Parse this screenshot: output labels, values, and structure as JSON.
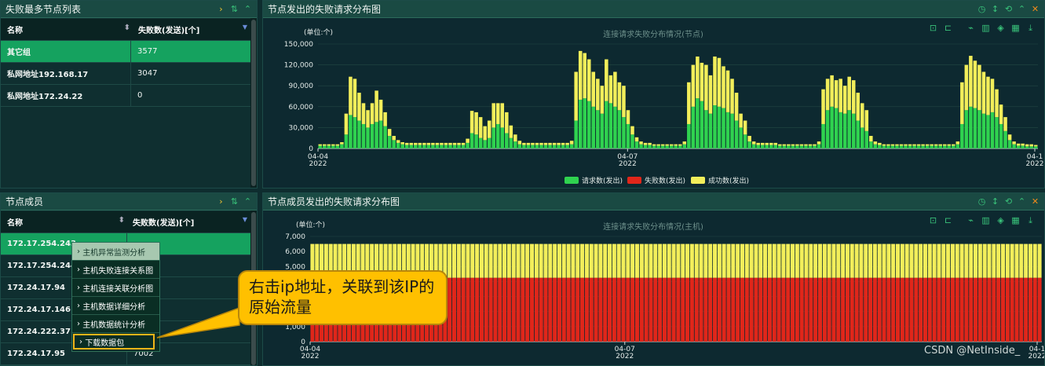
{
  "colors": {
    "request": "#2fd24f",
    "fail": "#e0261a",
    "success": "#f2ee5a",
    "accent": "#15a25f"
  },
  "left_top": {
    "title": "失败最多节点列表",
    "col_name": "名称",
    "col_fail": "失败数(发送)[个]",
    "rows": [
      {
        "name": "其它组",
        "value": "3577"
      },
      {
        "name": "私网地址192.168.17",
        "value": "3047"
      },
      {
        "name": "私网地址172.24.22",
        "value": "0"
      }
    ]
  },
  "left_bottom": {
    "title": "节点成员",
    "col_name": "名称",
    "col_fail": "失败数(发送)[个]",
    "rows": [
      {
        "name": "172.17.254.243",
        "value": ""
      },
      {
        "name": "172.17.254.244",
        "value": ""
      },
      {
        "name": "172.24.17.94",
        "value": ""
      },
      {
        "name": "172.24.17.146",
        "value": ""
      },
      {
        "name": "172.24.222.37",
        "value": ""
      },
      {
        "name": "172.24.17.95",
        "value": "7002"
      }
    ]
  },
  "context_menu": {
    "items": [
      "主机异常监测分析",
      "主机失败连接关系图",
      "主机连接关联分析图",
      "主机数据详细分析",
      "主机数据统计分析",
      "下载数据包"
    ]
  },
  "callout": {
    "text": "右击ip地址，关联到该IP的原始流量"
  },
  "top_chart_panel": {
    "title": "节点发出的失败请求分布图"
  },
  "bottom_chart_panel": {
    "title": "节点成员发出的失败请求分布图"
  },
  "watermark": "CSDN @NetInside_",
  "chart_data": [
    {
      "type": "bar",
      "title": "连接请求失败分布情况(节点)",
      "unit": "(单位:个)",
      "yticks": [
        "0",
        "30,000",
        "60,000",
        "90,000",
        "120,000",
        "150,000"
      ],
      "ylim": [
        0,
        150000
      ],
      "xticks": [
        {
          "label": "04-04",
          "year": "2022",
          "at": 0
        },
        {
          "label": "04-07",
          "year": "2022",
          "at": 36
        },
        {
          "label": "04-1",
          "year": "2022",
          "at": 84
        }
      ],
      "legend": [
        "请求数(发出)",
        "失败数(发出)",
        "成功数(发出)"
      ],
      "series": [
        {
          "name": "请求数(发出)",
          "values": [
            4000,
            4000,
            4000,
            4000,
            4000,
            6000,
            20000,
            48000,
            45000,
            40000,
            35000,
            30000,
            35000,
            38000,
            40000,
            32000,
            18000,
            12000,
            8000,
            6000,
            5000,
            5000,
            5000,
            5000,
            5000,
            5000,
            5000,
            5000,
            5000,
            5000,
            5000,
            5000,
            5000,
            5000,
            8000,
            22000,
            20000,
            15000,
            12000,
            15000,
            30000,
            35000,
            30000,
            22000,
            15000,
            10000,
            6000,
            5000,
            5000,
            5000,
            5000,
            5000,
            5000,
            5000,
            5000,
            5000,
            5000,
            5000,
            6000,
            40000,
            70000,
            72000,
            68000,
            60000,
            55000,
            50000,
            68000,
            65000,
            60000,
            55000,
            45000,
            35000,
            20000,
            10000,
            6000,
            5000,
            5000,
            4000,
            4000,
            4000,
            4000,
            4000,
            4000,
            4000,
            6000,
            35000,
            60000,
            72000,
            68000,
            55000,
            50000,
            62000,
            60000,
            58000,
            52000,
            50000,
            40000,
            30000,
            20000,
            10000,
            6000,
            5000,
            5000,
            5000,
            5000,
            5000,
            4000,
            4000,
            4000,
            4000,
            4000,
            4000,
            4000,
            4000,
            4000,
            6000,
            35000,
            55000,
            60000,
            58000,
            52000,
            50000,
            55000,
            50000,
            40000,
            30000,
            25000,
            10000,
            6000,
            5000,
            4000,
            4000,
            4000,
            4000,
            4000,
            4000,
            4000,
            4000,
            4000,
            4000,
            4000,
            4000,
            4000,
            4000,
            4000,
            4000,
            4000,
            6000,
            35000,
            55000,
            60000,
            58000,
            55000,
            50000,
            48000,
            52000,
            45000,
            35000,
            25000,
            12000,
            6000,
            4000,
            4000,
            3000,
            3000,
            3000
          ]
        },
        {
          "name": "失败数(发出)",
          "values": [
            0,
            0,
            0,
            0,
            0,
            0,
            0,
            0,
            0,
            0,
            0,
            0,
            0,
            0,
            0,
            0,
            0,
            0,
            0,
            0,
            0,
            0,
            0,
            0,
            0,
            0,
            0,
            0,
            0,
            0,
            0,
            0,
            0,
            0,
            0,
            0,
            0,
            0,
            0,
            0,
            0,
            0,
            0,
            0,
            0,
            0,
            0,
            0,
            0,
            0,
            0,
            0,
            0,
            0,
            0,
            0,
            0,
            0,
            0,
            0,
            0,
            0,
            0,
            0,
            0,
            0,
            0,
            0,
            0,
            0,
            0,
            0,
            0,
            0,
            0,
            0,
            0,
            0,
            0,
            0,
            0,
            0,
            0,
            0,
            0,
            0,
            0,
            0,
            0,
            0,
            0,
            0,
            0,
            0,
            0,
            0,
            0,
            0,
            0,
            0,
            0,
            0,
            0,
            0,
            0,
            0,
            0,
            0,
            0,
            0,
            0,
            0,
            0,
            0,
            0,
            0,
            0,
            0,
            0,
            0,
            0,
            0,
            0,
            0,
            0,
            0,
            0,
            0,
            0,
            0,
            0,
            0,
            0,
            0,
            0,
            0,
            0,
            0,
            0,
            0,
            0,
            0,
            0,
            0,
            0,
            0,
            0,
            0,
            0,
            0,
            0,
            0,
            0,
            0,
            0,
            0,
            0,
            0,
            0,
            0,
            0,
            0,
            0,
            0,
            0,
            0,
            0,
            0,
            0,
            0
          ]
        },
        {
          "name": "成功数(发出)",
          "values": [
            2000,
            2000,
            2000,
            2000,
            2000,
            3000,
            30000,
            55000,
            55000,
            40000,
            30000,
            25000,
            30000,
            45000,
            30000,
            20000,
            10000,
            6000,
            4000,
            3000,
            3000,
            3000,
            3000,
            3000,
            3000,
            3000,
            3000,
            3000,
            3000,
            3000,
            3000,
            3000,
            3000,
            3000,
            6000,
            32000,
            32000,
            30000,
            20000,
            25000,
            35000,
            30000,
            35000,
            30000,
            18000,
            10000,
            5000,
            3000,
            3000,
            3000,
            3000,
            3000,
            3000,
            3000,
            3000,
            3000,
            3000,
            3000,
            5000,
            70000,
            70000,
            65000,
            60000,
            50000,
            45000,
            40000,
            60000,
            40000,
            50000,
            40000,
            45000,
            20000,
            12000,
            6000,
            4000,
            3000,
            3000,
            2000,
            2000,
            2000,
            2000,
            2000,
            2000,
            2000,
            4000,
            60000,
            60000,
            60000,
            55000,
            65000,
            55000,
            70000,
            70000,
            60000,
            60000,
            50000,
            40000,
            20000,
            20000,
            8000,
            4000,
            3000,
            3000,
            3000,
            3000,
            3000,
            2000,
            2000,
            2000,
            2000,
            2000,
            2000,
            2000,
            2000,
            2000,
            4000,
            50000,
            45000,
            45000,
            40000,
            48000,
            40000,
            48000,
            48000,
            40000,
            35000,
            30000,
            8000,
            4000,
            3000,
            2000,
            2000,
            2000,
            2000,
            2000,
            2000,
            2000,
            2000,
            2000,
            2000,
            2000,
            2000,
            2000,
            2000,
            2000,
            2000,
            2000,
            4000,
            60000,
            65000,
            73000,
            68000,
            65000,
            60000,
            55000,
            48000,
            40000,
            28000,
            20000,
            8000,
            4000,
            3000,
            3000,
            3000,
            3000,
            2000
          ]
        }
      ]
    },
    {
      "type": "bar",
      "title": "连接请求失败分布情况(主机)",
      "unit": "(单位:个)",
      "yticks": [
        "0",
        "1,000",
        "2,000",
        "3,000",
        "4,000",
        "5,000",
        "6,000",
        "7,000"
      ],
      "ylim": [
        0,
        7000
      ],
      "xticks": [
        {
          "label": "04-04",
          "year": "2022",
          "at": 0
        },
        {
          "label": "04-07",
          "year": "2022",
          "at": 36
        },
        {
          "label": "04-1",
          "year": "2022",
          "at": 84
        }
      ],
      "bar_count": 160,
      "series": [
        {
          "name": "失败数(发出)",
          "value": 4250
        },
        {
          "name": "成功数(发出)",
          "value": 2250
        }
      ]
    }
  ]
}
